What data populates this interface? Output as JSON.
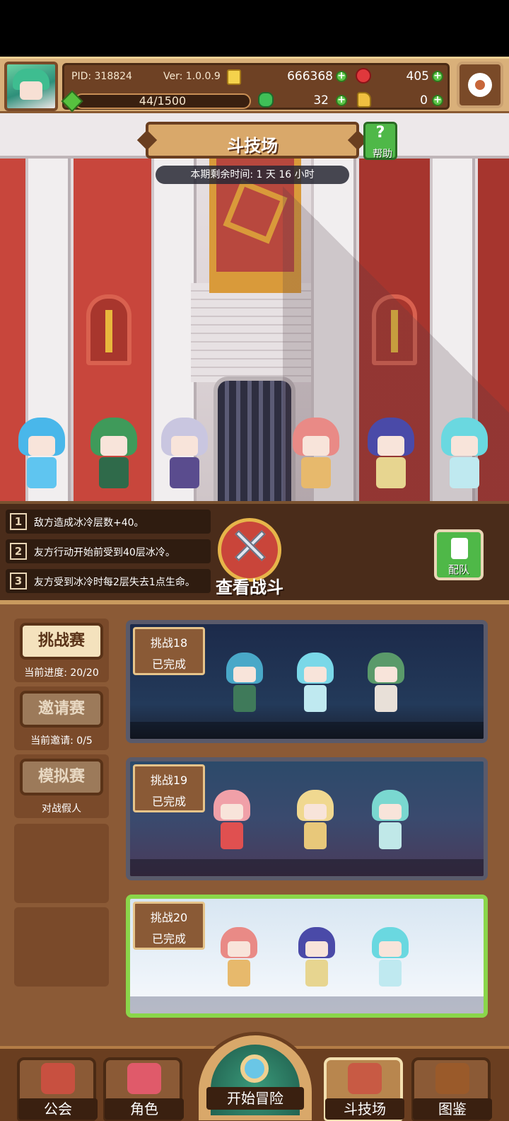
{
  "header": {
    "pid": "PID: 318824",
    "version": "Ver: 1.0.0.9",
    "gold": "666368",
    "gems": "405",
    "stamina": "44/1500",
    "clover": "32",
    "keys": "0"
  },
  "arena": {
    "title": "斗技场",
    "help_label": "帮助",
    "help_glyph": "?",
    "timer": "本期剩余时间: 1 天 16 小时"
  },
  "rules": [
    {
      "num": "1",
      "text": "敌方造成冰冷层数+40。"
    },
    {
      "num": "2",
      "text": "友方行动开始前受到40层冰冷。"
    },
    {
      "num": "3",
      "text": "友方受到冰冷时每2层失去1点生命。"
    }
  ],
  "actions": {
    "view_battle": "查看战斗",
    "team": "配队"
  },
  "modes": [
    {
      "label": "挑战赛",
      "sub": "当前进度: 20/20",
      "active": true
    },
    {
      "label": "邀请赛",
      "sub": "当前邀请: 0/5",
      "active": false
    },
    {
      "label": "模拟赛",
      "sub": "对战假人",
      "active": false
    }
  ],
  "challenges": [
    {
      "title": "挑战18",
      "status": "已完成"
    },
    {
      "title": "挑战19",
      "status": "已完成"
    },
    {
      "title": "挑战20",
      "status": "已完成"
    }
  ],
  "nav": {
    "guild": "公会",
    "character": "角色",
    "adventure": "开始冒险",
    "arena": "斗技场",
    "codex": "图鉴"
  },
  "colors": {
    "accent_green": "#4fb848",
    "panel_brown": "#8b5a36",
    "wall_red": "#c8463c"
  }
}
